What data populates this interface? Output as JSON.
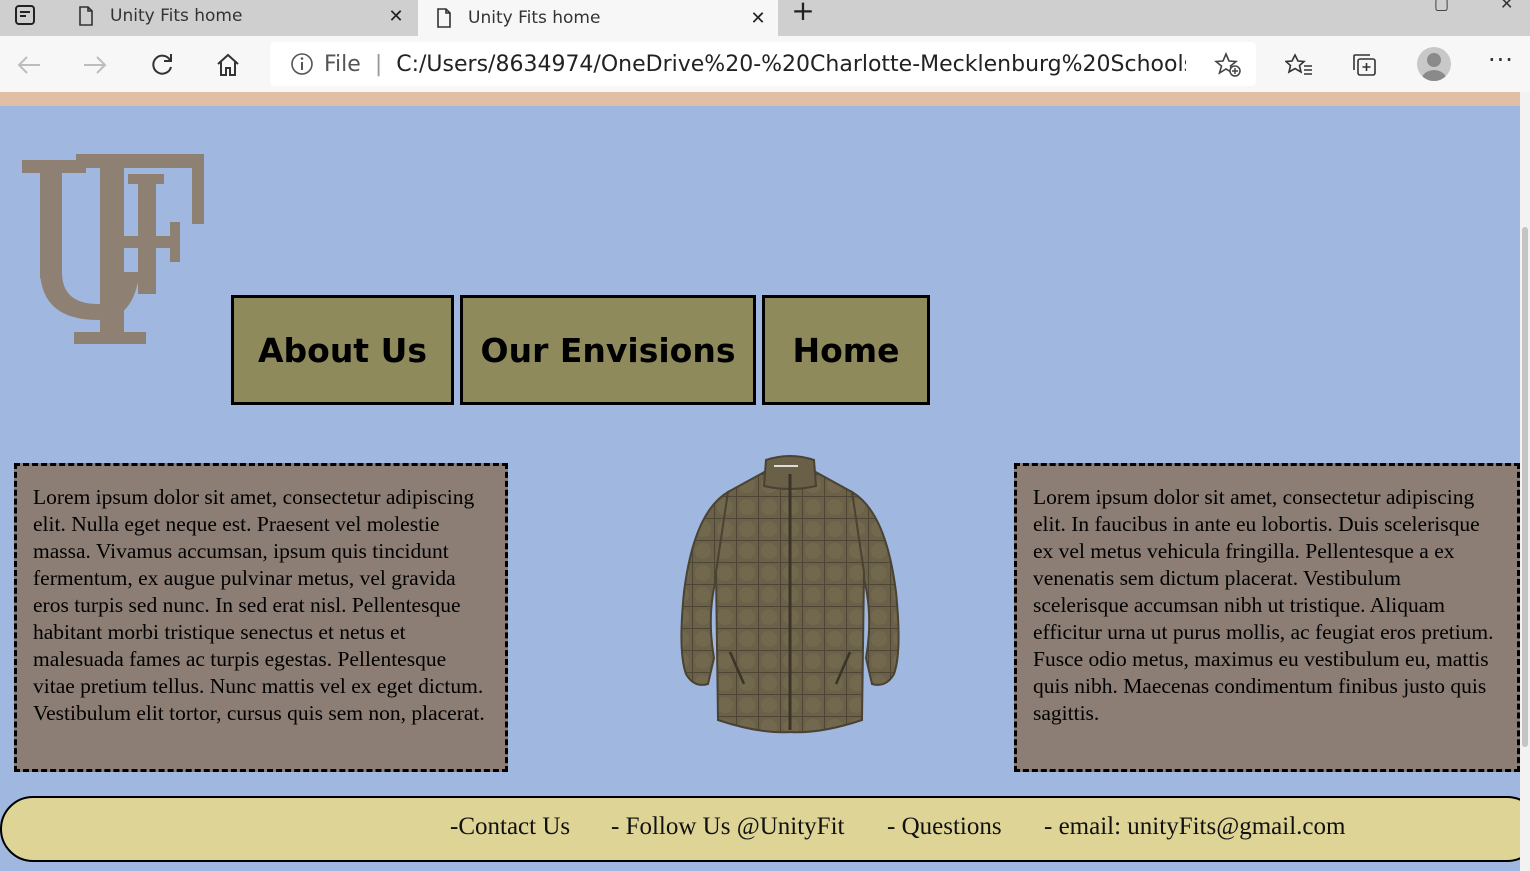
{
  "browser": {
    "tabs": [
      {
        "title": "Unity Fits home",
        "active": false
      },
      {
        "title": "Unity Fits home",
        "active": true
      }
    ],
    "address": {
      "scheme_label": "File",
      "url": "C:/Users/8634974/OneDrive%20-%20Charlotte-Mecklenburg%20Schools..."
    }
  },
  "site": {
    "logo_text": "UF",
    "nav": [
      {
        "label": "About Us"
      },
      {
        "label": "Our Envisions"
      },
      {
        "label": "Home"
      }
    ],
    "left_text": "Lorem ipsum dolor sit amet, consectetur adipiscing elit. Nulla eget neque est. Praesent vel molestie massa. Vivamus accumsan, ipsum quis tincidunt fermentum, ex augue pulvinar metus, vel gravida eros turpis sed nunc. In sed erat nisl. Pellentesque habitant morbi tristique senectus et netus et malesuada fames ac turpis egestas. Pellentesque vitae pretium tellus. Nunc mattis vel ex eget dictum. Vestibulum elit tortor, cursus quis sem non, placerat.",
    "right_text": "Lorem ipsum dolor sit amet, consectetur adipiscing elit. In faucibus in ante eu lobortis. Duis scelerisque ex vel metus vehicula fringilla. Pellentesque a ex venenatis sem dictum placerat. Vestibulum scelerisque accumsan nibh ut tristique. Aliquam efficitur urna ut purus mollis, ac feugiat eros pretium. Fusce odio metus, maximus eu vestibulum eu, mattis quis nibh. Maecenas condimentum finibus justo quis sagittis.",
    "footer": {
      "contact": "-Contact Us",
      "follow": "- Follow Us @UnityFit",
      "questions": "- Questions",
      "email": "- email: unityFits@gmail.com"
    }
  },
  "colors": {
    "page_bg": "#a0b8e0",
    "top_strip": "#e0bfa6",
    "nav_button": "#8f8a5c",
    "text_box": "#8c7e75",
    "footer": "#ddd496",
    "logo": "#8f8074"
  }
}
